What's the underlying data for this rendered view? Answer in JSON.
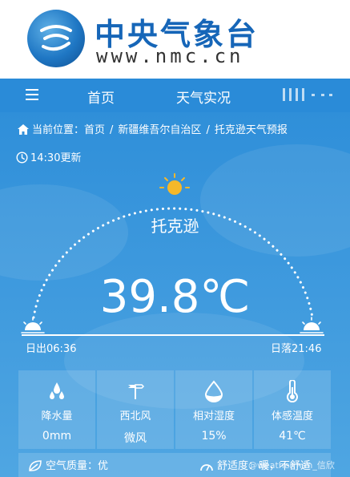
{
  "site": {
    "name": "中央气象台",
    "url": "www.nmc.cn"
  },
  "nav": {
    "tabs": [
      "首页",
      "天气实况"
    ]
  },
  "breadcrumb": {
    "label": "当前位置：",
    "items": [
      "首页",
      "新疆维吾尔自治区",
      "托克逊天气预报"
    ],
    "separator": "/"
  },
  "update": {
    "text": "14:30更新"
  },
  "weather": {
    "city": "托克逊",
    "temperature": "39.8℃",
    "sunrise": "日出06:36",
    "sunset": "日落21:46"
  },
  "tiles": [
    {
      "label": "降水量",
      "value": "0mm",
      "icon": "rain-drops-icon"
    },
    {
      "label": "西北风",
      "value": "微风",
      "icon": "wind-vane-icon"
    },
    {
      "label": "相对湿度",
      "value": "15%",
      "icon": "humidity-drop-icon"
    },
    {
      "label": "体感温度",
      "value": "41℃",
      "icon": "thermometer-icon"
    }
  ],
  "air_quality": {
    "text": "空气质量：优"
  },
  "comfort": {
    "text": "舒适度：暖，不舒适"
  },
  "watermark": {
    "text": "@weatherman_信欣"
  },
  "colors": {
    "brand": "#1666b8",
    "nav": "#2a8bd8",
    "sky": "#3c98dd",
    "sun": "#f5b82a"
  }
}
